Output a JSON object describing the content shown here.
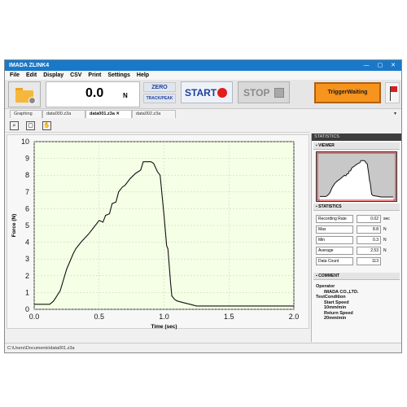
{
  "window": {
    "title": "IMADA ZLINK4",
    "controls": "— ▢ ✕"
  },
  "menu": [
    "File",
    "Edit",
    "Display",
    "CSV",
    "Print",
    "Settings",
    "Help"
  ],
  "toolbar": {
    "readout_value": "0.0",
    "readout_unit": "N",
    "zero_label": "ZERO",
    "track_label": "TRACK/PEAK",
    "start_label": "START",
    "stop_label": "STOP",
    "trigger_label": "TriggerWaiting"
  },
  "tabs": [
    {
      "label": "Graphing",
      "active": false
    },
    {
      "label": "data000.z3a",
      "active": false
    },
    {
      "label": "data001.z3a",
      "active": true,
      "close": "✕"
    },
    {
      "label": "data002.z3a",
      "active": false
    }
  ],
  "colors": {
    "plot_bg": "#f5ffe6",
    "curve": "#111111",
    "title_bar": "#1a78c8",
    "trigger": "#f7941d",
    "start_dot": "#e31c1c"
  },
  "chart_data": {
    "type": "line",
    "xlabel": "Time (sec)",
    "ylabel": "Force (N)",
    "xlim": [
      0,
      2.0
    ],
    "ylim": [
      0,
      10
    ],
    "xticks": [
      "0.0",
      "0.5",
      "1.0",
      "1.5",
      "2.0"
    ],
    "yticks": [
      "0",
      "1",
      "2",
      "3",
      "4",
      "5",
      "6",
      "7",
      "8",
      "9",
      "10"
    ],
    "grid": true,
    "series": [
      {
        "x": [
          0.0,
          0.12,
          0.15,
          0.2,
          0.25,
          0.3,
          0.32,
          0.36,
          0.42,
          0.46,
          0.5,
          0.53,
          0.55,
          0.58,
          0.6,
          0.63,
          0.65,
          0.68,
          0.7,
          0.74,
          0.78,
          0.82,
          0.84,
          0.88,
          0.9,
          0.92,
          0.95,
          0.97,
          1.0,
          1.02,
          1.03,
          1.05,
          1.06,
          1.08,
          1.1,
          1.15,
          1.2,
          1.25,
          1.3,
          1.5,
          2.0
        ],
        "y": [
          0.3,
          0.3,
          0.5,
          1.1,
          2.4,
          3.3,
          3.6,
          4.0,
          4.5,
          4.9,
          5.3,
          5.2,
          5.6,
          5.7,
          6.3,
          6.4,
          7.0,
          7.3,
          7.4,
          7.8,
          8.1,
          8.3,
          8.8,
          8.8,
          8.8,
          8.7,
          8.2,
          8.0,
          5.6,
          3.8,
          3.6,
          1.6,
          0.8,
          0.6,
          0.5,
          0.4,
          0.3,
          0.2,
          0.2,
          0.2,
          0.2
        ]
      }
    ]
  },
  "panel": {
    "header": "STATISTICS",
    "viewer_label": "VIEWER",
    "statistics_label": "STATISTICS",
    "comment_label": "COMMENT",
    "stats": [
      {
        "label": "Recording Rate",
        "value": "0.02",
        "unit": "sec"
      },
      {
        "label": "Max",
        "value": "8.8",
        "unit": "N"
      },
      {
        "label": "Min",
        "value": "0.3",
        "unit": "N"
      },
      {
        "label": "Average",
        "value": "2.53",
        "unit": "N"
      },
      {
        "label": "Data Count",
        "value": "113",
        "unit": ""
      }
    ],
    "comment_lines": [
      "Operator",
      "IMADA CO.,LTD.",
      "TestCondition",
      "Start Speed",
      "10mm/min",
      "Return Speed",
      "20mm/min"
    ]
  },
  "status": {
    "path": "C:\\Users\\Documents\\data001.z3a"
  }
}
